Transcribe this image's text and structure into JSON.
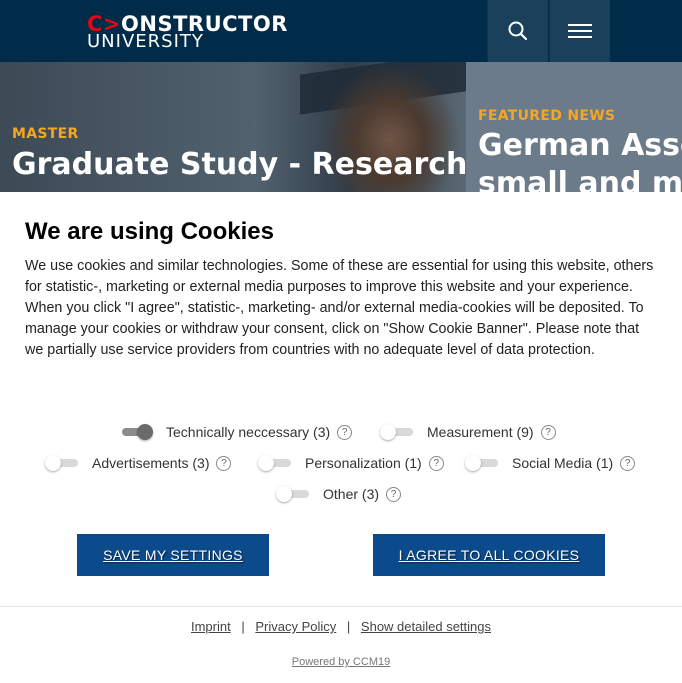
{
  "header": {
    "logo_top_mark": "C",
    "logo_top_arrow": ">",
    "logo_top_rest": "ONSTRUCTOR",
    "logo_bottom": "UNIVERSITY",
    "search_icon": "search-icon",
    "menu_icon": "hamburger-menu-icon",
    "colors": {
      "background": "#002b49",
      "button": "#1a405b",
      "accent": "#e30613"
    }
  },
  "hero": {
    "left": {
      "kicker": "MASTER",
      "title": "Graduate Study - Research-"
    },
    "right": {
      "kicker": "FEATURED NEWS",
      "title_line1": "German Asso",
      "title_line2": "small and me"
    },
    "colors": {
      "kicker": "#f6a623"
    }
  },
  "cookie_banner": {
    "title": "We are using Cookies",
    "text": "We use cookies and similar technologies. Some of these are essential for using this website, others for statistic-, marketing or external media purposes to improve this website and your experience. When you click \"I agree\", statistic-, marketing- and/or external media-cookies will be deposited. To manage your cookies or withdraw your consent, click on \"Show Cookie Banner\". Please note that we partially use service providers from countries with no adequate level of data protection.",
    "options": {
      "technical": {
        "label": "Technically neccessary (3)",
        "enabled": true
      },
      "measurement": {
        "label": "Measurement (9)",
        "enabled": false
      },
      "advertisements": {
        "label": "Advertisements (3)",
        "enabled": false
      },
      "personalization": {
        "label": "Personalization (1)",
        "enabled": false
      },
      "social_media": {
        "label": "Social Media (1)",
        "enabled": false
      },
      "other": {
        "label": "Other (3)",
        "enabled": false
      }
    },
    "help_glyph": "?",
    "save_button": "SAVE MY SETTINGS",
    "agree_button": "I AGREE TO ALL COOKIES",
    "links": {
      "imprint": "Imprint",
      "privacy": "Privacy Policy",
      "detailed": "Show detailed settings",
      "separator": "|"
    },
    "powered_by": "Powered by CCM19",
    "colors": {
      "button": "#0b4a8b"
    }
  }
}
